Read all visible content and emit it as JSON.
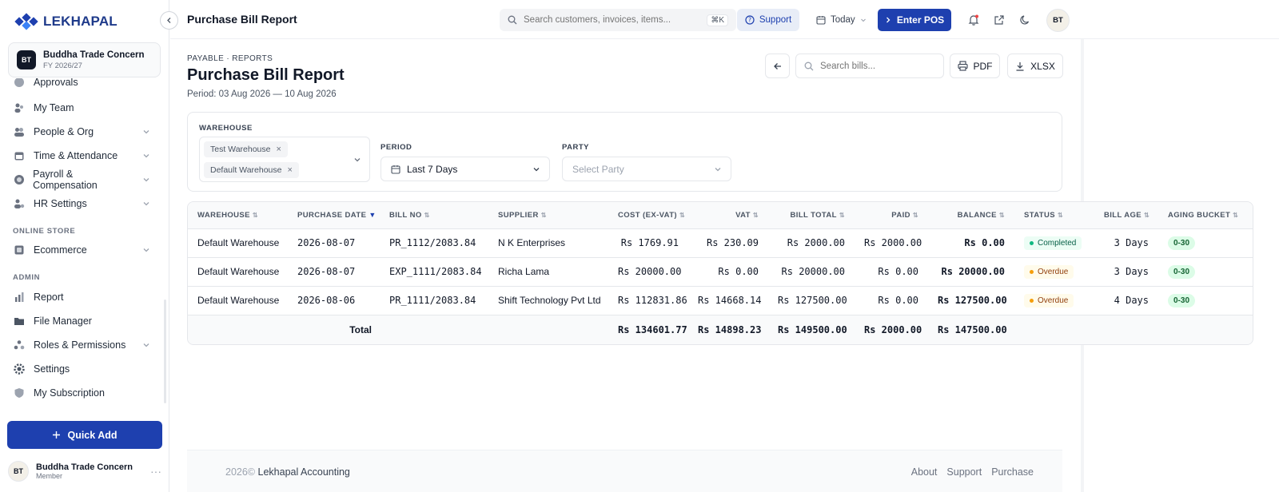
{
  "brand": {
    "name": "LEKHAPAL"
  },
  "org": {
    "initials": "BT",
    "name": "Buddha Trade Concern",
    "fy": "FY 2026/27"
  },
  "sidebar": {
    "partial_item": "Approvals",
    "items": [
      {
        "label": "My Team",
        "icon": "team-icon",
        "chevron": false
      },
      {
        "label": "People & Org",
        "icon": "people-icon",
        "chevron": true
      },
      {
        "label": "Time & Attendance",
        "icon": "calendar-icon",
        "chevron": true
      },
      {
        "label": "Payroll & Compensation",
        "icon": "payroll-icon",
        "chevron": true
      },
      {
        "label": "HR Settings",
        "icon": "hr-settings-icon",
        "chevron": true
      }
    ],
    "section_online_store": "ONLINE STORE",
    "online_store_items": [
      {
        "label": "Ecommerce",
        "icon": "store-icon",
        "chevron": true
      }
    ],
    "section_admin": "ADMIN",
    "admin_items": [
      {
        "label": "Report",
        "icon": "report-icon",
        "chevron": false
      },
      {
        "label": "File Manager",
        "icon": "folder-icon",
        "chevron": false
      },
      {
        "label": "Roles & Permissions",
        "icon": "roles-icon",
        "chevron": true
      },
      {
        "label": "Settings",
        "icon": "gear-icon",
        "chevron": false
      },
      {
        "label": "My Subscription",
        "icon": "shield-icon",
        "chevron": false
      }
    ],
    "quick_add": "Quick Add",
    "user": {
      "initials": "BT",
      "name": "Buddha Trade Concern",
      "role": "Member"
    }
  },
  "topbar": {
    "title": "Purchase Bill Report",
    "search_placeholder": "Search customers, invoices, items...",
    "search_shortcut": "⌘K",
    "support": "Support",
    "date_range": "Today",
    "enter_pos": "Enter POS",
    "avatar": "BT"
  },
  "report": {
    "breadcrumb": "PAYABLE · REPORTS",
    "title": "Purchase Bill Report",
    "period": "Period: 03 Aug 2026 — 10 Aug 2026",
    "search_placeholder": "Search bills...",
    "pdf": "PDF",
    "xlsx": "XLSX"
  },
  "filters": {
    "warehouse_label": "WAREHOUSE",
    "warehouses": [
      "Test Warehouse",
      "Default Warehouse"
    ],
    "period_label": "PERIOD",
    "period_value": "Last 7 Days",
    "party_label": "PARTY",
    "party_placeholder": "Select Party"
  },
  "table": {
    "columns": [
      "WAREHOUSE",
      "PURCHASE DATE",
      "BILL NO",
      "SUPPLIER",
      "COST (EX-VAT)",
      "VAT",
      "BILL TOTAL",
      "PAID",
      "BALANCE",
      "STATUS",
      "BILL AGE",
      "AGING BUCKET"
    ],
    "rows": [
      {
        "warehouse": "Default Warehouse",
        "date": "2026-08-07",
        "bill_no": "PR_1112/2083.84",
        "supplier": "N K Enterprises",
        "cost": "Rs 1769.91",
        "vat": "Rs 230.09",
        "total": "Rs 2000.00",
        "paid": "Rs 2000.00",
        "balance": "Rs 0.00",
        "status": "Completed",
        "age": "3 Days",
        "bucket": "0-30"
      },
      {
        "warehouse": "Default Warehouse",
        "date": "2026-08-07",
        "bill_no": "EXP_1111/2083.84",
        "supplier": "Richa Lama",
        "cost": "Rs 20000.00",
        "vat": "Rs 0.00",
        "total": "Rs 20000.00",
        "paid": "Rs 0.00",
        "balance": "Rs 20000.00",
        "status": "Overdue",
        "age": "3 Days",
        "bucket": "0-30"
      },
      {
        "warehouse": "Default Warehouse",
        "date": "2026-08-06",
        "bill_no": "PR_1111/2083.84",
        "supplier": "Shift Technology Pvt Ltd",
        "cost": "Rs 112831.86",
        "vat": "Rs 14668.14",
        "total": "Rs 127500.00",
        "paid": "Rs 0.00",
        "balance": "Rs 127500.00",
        "status": "Overdue",
        "age": "4 Days",
        "bucket": "0-30"
      }
    ],
    "total": {
      "label": "Total",
      "cost": "Rs 134601.77",
      "vat": "Rs 14898.23",
      "total": "Rs 149500.00",
      "paid": "Rs 2000.00",
      "balance": "Rs 147500.00"
    }
  },
  "footer": {
    "year": "2026©",
    "company": "Lekhapal Accounting",
    "links": [
      "About",
      "Support",
      "Purchase"
    ]
  },
  "colors": {
    "accent": "#1e40af",
    "completed": "#10b981",
    "overdue": "#f59e0b",
    "aging": "#dcfce7"
  }
}
